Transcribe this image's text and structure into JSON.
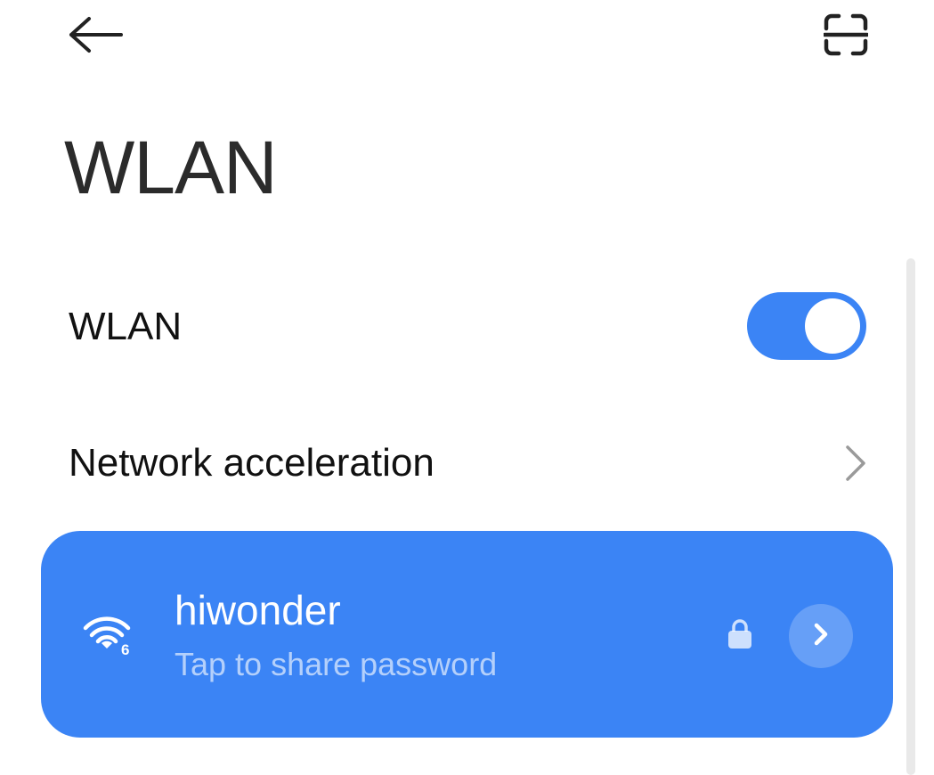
{
  "header": {
    "back_icon": "arrow-left-icon",
    "scan_icon": "scan-qr-icon",
    "title": "WLAN"
  },
  "wlan_toggle": {
    "label": "WLAN",
    "state": "on",
    "accent_color": "#3b84f5"
  },
  "network_acceleration": {
    "label": "Network acceleration",
    "icon": "chevron-right-icon"
  },
  "connected_network": {
    "name": "hiwonder",
    "subtitle": "Tap to share password",
    "wifi_badge": "6",
    "signal_icon": "wifi-6-signal-icon",
    "lock_icon": "lock-icon",
    "details_icon": "chevron-right-icon",
    "card_color": "#3b84f5"
  }
}
